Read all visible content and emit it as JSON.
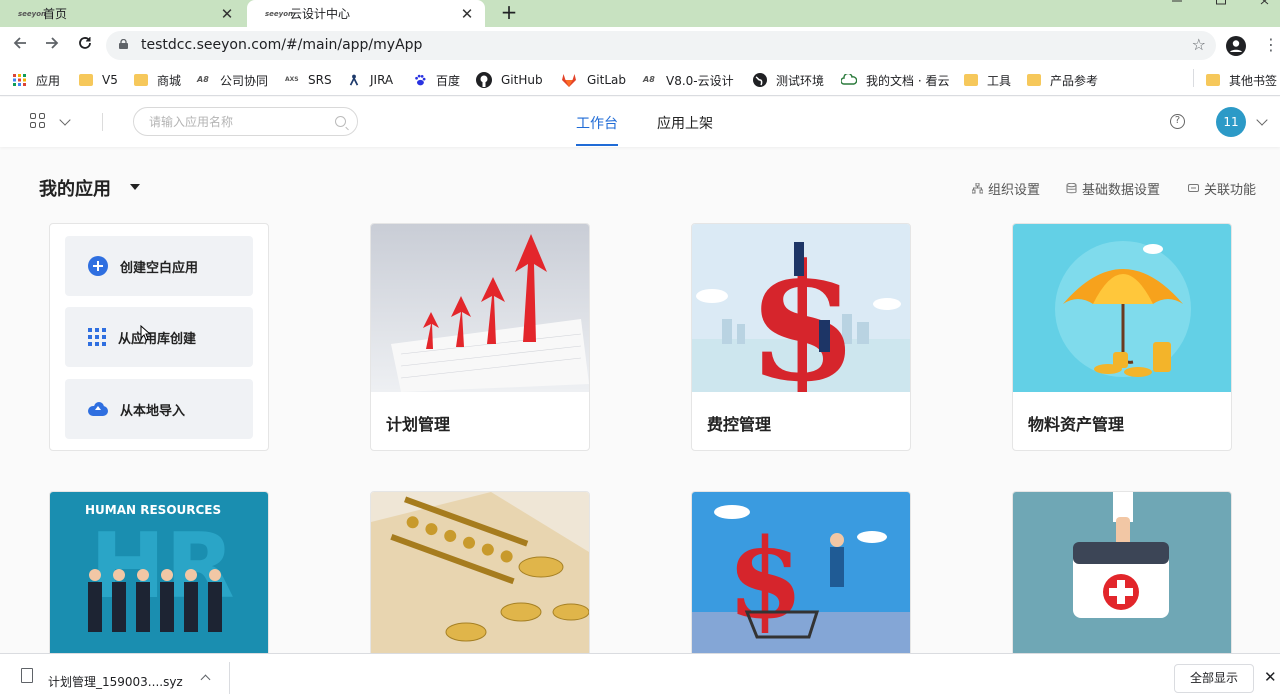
{
  "browser": {
    "tabs": [
      {
        "title": "首页",
        "favicon": "seeyon-logo-icon",
        "active": false
      },
      {
        "title": "云设计中心",
        "favicon": "seeyon-logo-icon",
        "active": true
      }
    ],
    "favicon_text": "seeyon",
    "close_glyph": "✕",
    "new_tab_glyph": "+",
    "url": "testdcc.seeyon.com/#/main/app/myApp",
    "bookmarks": [
      {
        "label": "应用",
        "icon": "apps-grid-icon"
      },
      {
        "label": "V5",
        "icon": "folder-icon"
      },
      {
        "label": "商城",
        "icon": "folder-icon"
      },
      {
        "label": "公司协同",
        "icon": "a8-icon"
      },
      {
        "label": "SRS",
        "icon": "axure-icon"
      },
      {
        "label": "JIRA",
        "icon": "jira-icon"
      },
      {
        "label": "百度",
        "icon": "baidu-icon"
      },
      {
        "label": "GitHub",
        "icon": "github-icon"
      },
      {
        "label": "GitLab",
        "icon": "gitlab-icon"
      },
      {
        "label": "V8.0-云设计",
        "icon": "a8-icon"
      },
      {
        "label": "测试环境",
        "icon": "globe-icon"
      },
      {
        "label": "我的文档 · 看云",
        "icon": "kancloud-icon"
      },
      {
        "label": "工具",
        "icon": "folder-icon"
      },
      {
        "label": "产品参考",
        "icon": "folder-icon"
      },
      {
        "label": "其他书签",
        "icon": "folder-icon"
      }
    ]
  },
  "header": {
    "search_placeholder": "请输入应用名称",
    "nav": [
      {
        "label": "工作台",
        "active": true
      },
      {
        "label": "应用上架",
        "active": false
      }
    ],
    "help_glyph": "?",
    "avatar_text": "11",
    "accent_color": "#1f6bd6",
    "avatar_color": "#2c9ac7"
  },
  "section": {
    "title": "我的应用",
    "tools": [
      {
        "label": "组织设置",
        "icon": "org-icon"
      },
      {
        "label": "基础数据设置",
        "icon": "database-icon"
      },
      {
        "label": "关联功能",
        "icon": "link-icon"
      }
    ]
  },
  "create": {
    "blank": "创建空白应用",
    "from_library": "从应用库创建",
    "import_local": "从本地导入"
  },
  "apps": [
    {
      "name": "计划管理",
      "image": "growth-arrows-chart-image"
    },
    {
      "name": "费控管理",
      "image": "dollar-sign-climbers-image"
    },
    {
      "name": "物料资产管理",
      "image": "umbrella-coins-image"
    },
    {
      "name": "",
      "image": "human-resources-image",
      "image_text": "HUMAN RESOURCES"
    },
    {
      "name": "",
      "image": "abacus-coins-image"
    },
    {
      "name": "",
      "image": "dollar-cart-runner-image"
    },
    {
      "name": "",
      "image": "medical-kit-image"
    }
  ],
  "downloads": {
    "file_name": "计划管理_159003....syz",
    "show_all": "全部显示",
    "close_glyph": "✕"
  }
}
